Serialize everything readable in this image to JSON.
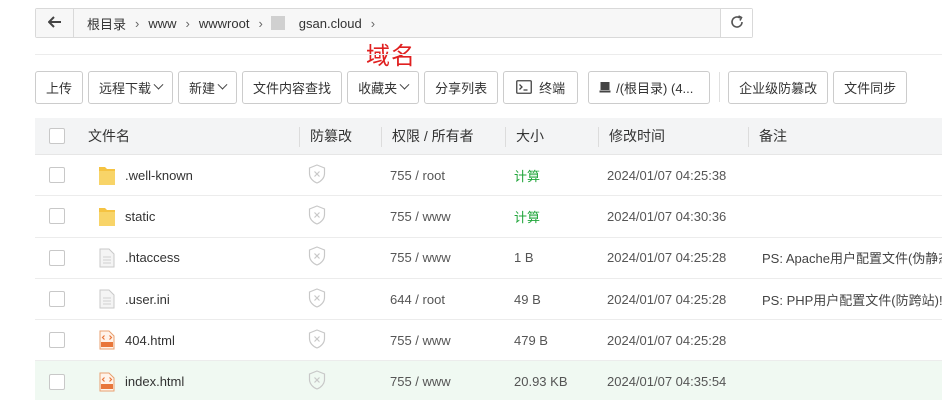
{
  "path_bar": {
    "crumbs": [
      "根目录",
      "www",
      "wwwroot",
      "gsan.cloud"
    ],
    "back_icon": "arrow-left-icon",
    "refresh_icon": "refresh-icon"
  },
  "annotation": {
    "text": "域名",
    "color": "#e02020"
  },
  "toolbar": {
    "upload": "上传",
    "remote_download": "远程下载",
    "new": "新建",
    "content_search": "文件内容查找",
    "favorites": "收藏夹",
    "share_list": "分享列表",
    "terminal": "终端",
    "disk": "/(根目录) (4...",
    "enterprise_tamper": "企业级防篡改",
    "file_sync": "文件同步"
  },
  "table": {
    "headers": {
      "name": "文件名",
      "protect": "防篡改",
      "perm": "权限 / 所有者",
      "size": "大小",
      "time": "修改时间",
      "note": "备注"
    },
    "rows": [
      {
        "name": ".well-known",
        "icon": "folder-icon",
        "perm": "755 / root",
        "size": "计算",
        "time": "2024/01/07 04:25:38",
        "note": ""
      },
      {
        "name": "static",
        "icon": "folder-icon",
        "perm": "755 / www",
        "size": "计算",
        "time": "2024/01/07 04:30:36",
        "note": ""
      },
      {
        "name": ".htaccess",
        "icon": "file-icon",
        "perm": "755 / www",
        "size": "1 B",
        "time": "2024/01/07 04:25:28",
        "note": "PS: Apache用户配置文件(伪静态"
      },
      {
        "name": ".user.ini",
        "icon": "file-icon",
        "perm": "644 / root",
        "size": "49 B",
        "time": "2024/01/07 04:25:28",
        "note": "PS: PHP用户配置文件(防跨站)!"
      },
      {
        "name": "404.html",
        "icon": "html-file-icon",
        "perm": "755 / www",
        "size": "479 B",
        "time": "2024/01/07 04:25:28",
        "note": ""
      },
      {
        "name": "index.html",
        "icon": "html-file-icon",
        "perm": "755 / www",
        "size": "20.93 KB",
        "time": "2024/01/07 04:35:54",
        "note": ""
      }
    ]
  },
  "colors": {
    "accent_green": "#20a53a",
    "folder": "#f5c342",
    "html_icon": "#e8763a"
  }
}
